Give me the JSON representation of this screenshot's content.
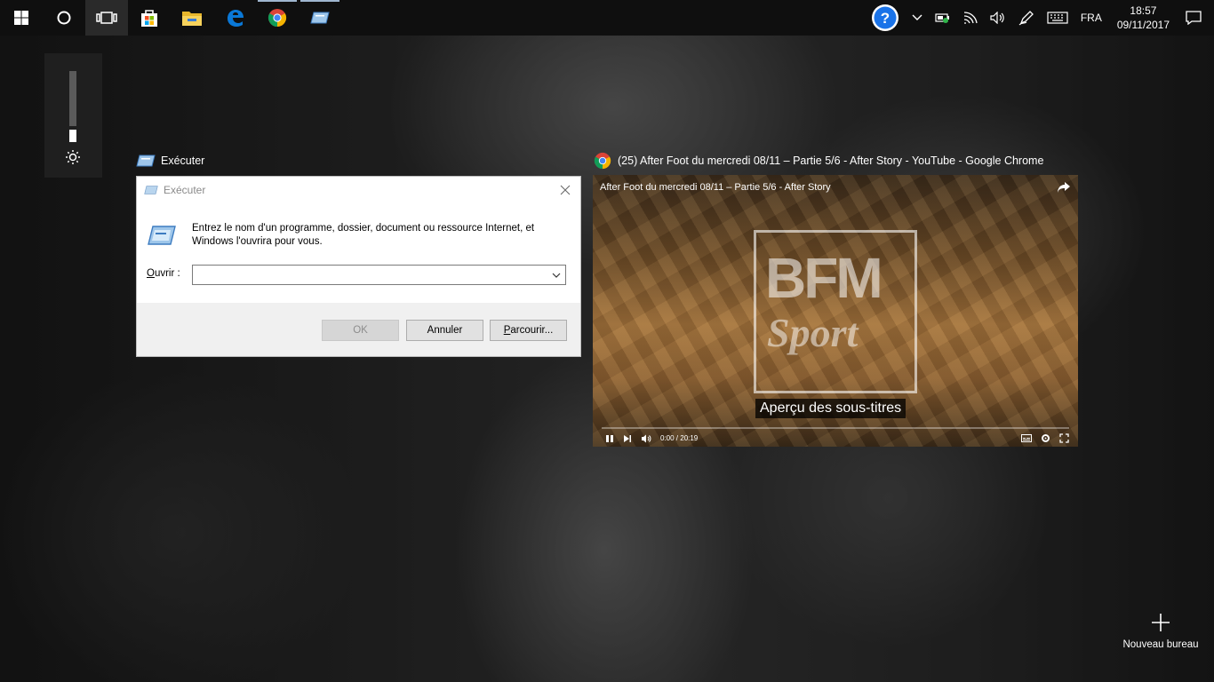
{
  "taskbar": {
    "apps": [
      {
        "name": "windows-start",
        "icon": "windows-logo-icon"
      },
      {
        "name": "cortana",
        "icon": "cortana-circle-icon"
      },
      {
        "name": "task-view",
        "icon": "task-view-icon"
      },
      {
        "name": "store",
        "icon": "store-bag-icon"
      },
      {
        "name": "file-explorer",
        "icon": "folder-icon"
      },
      {
        "name": "edge",
        "icon": "edge-icon"
      },
      {
        "name": "chrome",
        "icon": "chrome-icon"
      },
      {
        "name": "run",
        "icon": "run-icon"
      }
    ],
    "tray": {
      "language": "FRA",
      "time": "18:57",
      "date": "09/11/2017"
    }
  },
  "brightness": {
    "level": 0.2
  },
  "run_window": {
    "label": "Exécuter",
    "title": "Exécuter",
    "message": "Entrez le nom d'un programme, dossier, document ou ressource Internet, et Windows l'ouvrira pour vous.",
    "open_label_u": "O",
    "open_label_rest": "uvrir :",
    "open_value": "",
    "ok_label": "OK",
    "cancel_label": "Annuler",
    "browse_label_u": "P",
    "browse_label_rest": "arcourir..."
  },
  "chrome_window": {
    "label": "(25) After Foot du mercredi 08/11 – Partie 5/6 - After Story - YouTube - Google Chrome",
    "video_title": "After Foot du mercredi 08/11 – Partie 5/6 - After Story",
    "logo_top": "BFM",
    "logo_bottom": "Sport",
    "caption": "Aperçu des sous-titres",
    "time": "0:00 / 20:19"
  },
  "new_desktop": {
    "label": "Nouveau bureau"
  },
  "colors": {
    "taskbar_bg": "#0f0f0f",
    "running_indicator": "#9fb6cf",
    "help_blue": "#1a73e8",
    "edge_blue": "#0a78d7",
    "chrome_red": "#db4437",
    "chrome_yellow": "#f4b400",
    "chrome_green": "#0f9d58"
  }
}
